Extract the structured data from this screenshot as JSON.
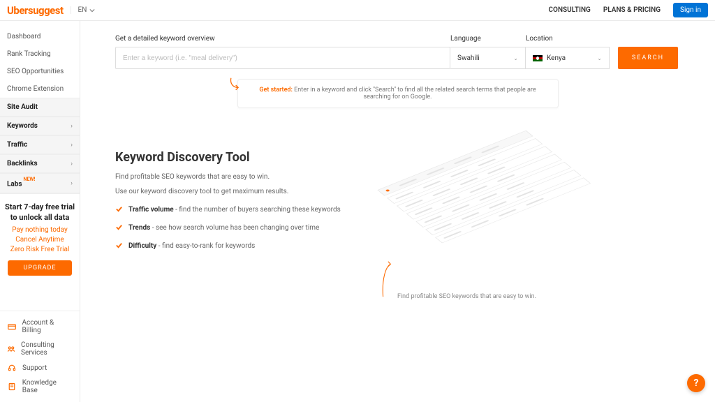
{
  "header": {
    "logo": "Ubersuggest",
    "lang": "EN",
    "consulting": "CONSULTING",
    "plans": "PLANS & PRICING",
    "signin": "Sign in"
  },
  "sidebar": {
    "simple": [
      "Dashboard",
      "Rank Tracking",
      "SEO Opportunities",
      "Chrome Extension"
    ],
    "heads": [
      "Site Audit",
      "Keywords",
      "Traffic",
      "Backlinks"
    ],
    "labs": "Labs",
    "labs_tag": "NEW!",
    "trial": {
      "title1": "Start 7-day free trial",
      "title2": "to unlock all data",
      "l1": "Pay nothing today",
      "l2": "Cancel Anytime",
      "l3": "Zero Risk Free Trial",
      "btn": "UPGRADE"
    },
    "footer": {
      "billing": "Account & Billing",
      "consult": "Consulting Services",
      "support": "Support",
      "kb": "Knowledge Base"
    }
  },
  "search": {
    "label_kw": "Get a detailed keyword overview",
    "placeholder": "Enter a keyword (i.e. \"meal delivery\")",
    "label_lang": "Language",
    "lang_value": "Swahili",
    "label_loc": "Location",
    "loc_value": "Kenya",
    "btn": "SEARCH"
  },
  "tip": {
    "lead": "Get started:",
    "body": " Enter in a keyword and click \"Search\" to find all the related search terms that people are searching for on Google."
  },
  "disc": {
    "title": "Keyword Discovery Tool",
    "p1": "Find profitable SEO keywords that are easy to win.",
    "p2": "Use our keyword discovery tool to get maximum results.",
    "b1t": "Traffic volume",
    "b1r": " - find the number of buyers searching these keywords",
    "b2t": "Trends",
    "b2r": " - see how search volume has been changing over time",
    "b3t": "Difficulty",
    "b3r": " - find easy-to-rank for keywords",
    "caption": "Find profitable SEO keywords that are easy to win."
  },
  "help": "?"
}
